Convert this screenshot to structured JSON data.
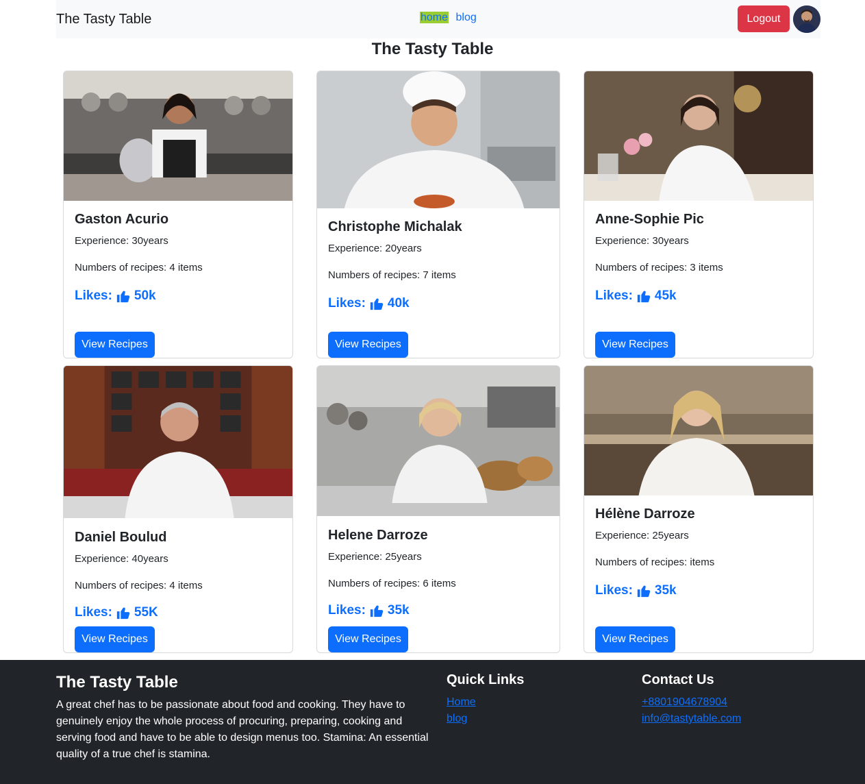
{
  "nav": {
    "brand": "The Tasty Table",
    "links": [
      {
        "label": "home"
      },
      {
        "label": "blog"
      }
    ],
    "logout_label": "Logout"
  },
  "page_title": "The Tasty Table",
  "chefs": [
    {
      "name": "Gaston Acurio",
      "experience": "Experience: 30years",
      "recipes": "Numbers of recipes: 4 items",
      "likes_label": "Likes:",
      "likes": "50k",
      "button": "View Recipes"
    },
    {
      "name": "Christophe Michalak",
      "experience": "Experience: 20years",
      "recipes": "Numbers of recipes: 7 items",
      "likes_label": "Likes:",
      "likes": "40k",
      "button": "View Recipes"
    },
    {
      "name": "Anne-Sophie Pic",
      "experience": "Experience: 30years",
      "recipes": "Numbers of recipes: 3 items",
      "likes_label": "Likes:",
      "likes": "45k",
      "button": "View Recipes"
    },
    {
      "name": "Daniel Boulud",
      "experience": "Experience: 40years",
      "recipes": "Numbers of recipes: 4 items",
      "likes_label": "Likes:",
      "likes": "55K",
      "button": "View Recipes"
    },
    {
      "name": "Helene Darroze",
      "experience": "Experience: 25years",
      "recipes": "Numbers of recipes: 6 items",
      "likes_label": "Likes:",
      "likes": "35k",
      "button": "View Recipes"
    },
    {
      "name": "Hélène Darroze",
      "experience": "Experience: 25years",
      "recipes": "Numbers of recipes: items",
      "likes_label": "Likes:",
      "likes": "35k",
      "button": "View Recipes"
    }
  ],
  "footer": {
    "title": "The Tasty Table",
    "description": "A great chef has to be passionate about food and cooking. They have to genuinely enjoy the whole process of procuring, preparing, cooking and serving food and have to be able to design menus too. Stamina: An essential quality of a true chef is stamina.",
    "quick_links_title": "Quick Links",
    "quick_links": [
      "Home",
      "blog"
    ],
    "contact_title": "Contact Us",
    "phone": "+8801904678904",
    "email": "info@tastytable.com"
  },
  "colors": {
    "primary": "#0d6efd",
    "danger": "#dc3545",
    "footer_bg": "#212529",
    "nav_bg": "#f8f9fa",
    "home_highlight": "#9acd32"
  },
  "icons": {
    "likes": "thumbs-up-icon"
  }
}
